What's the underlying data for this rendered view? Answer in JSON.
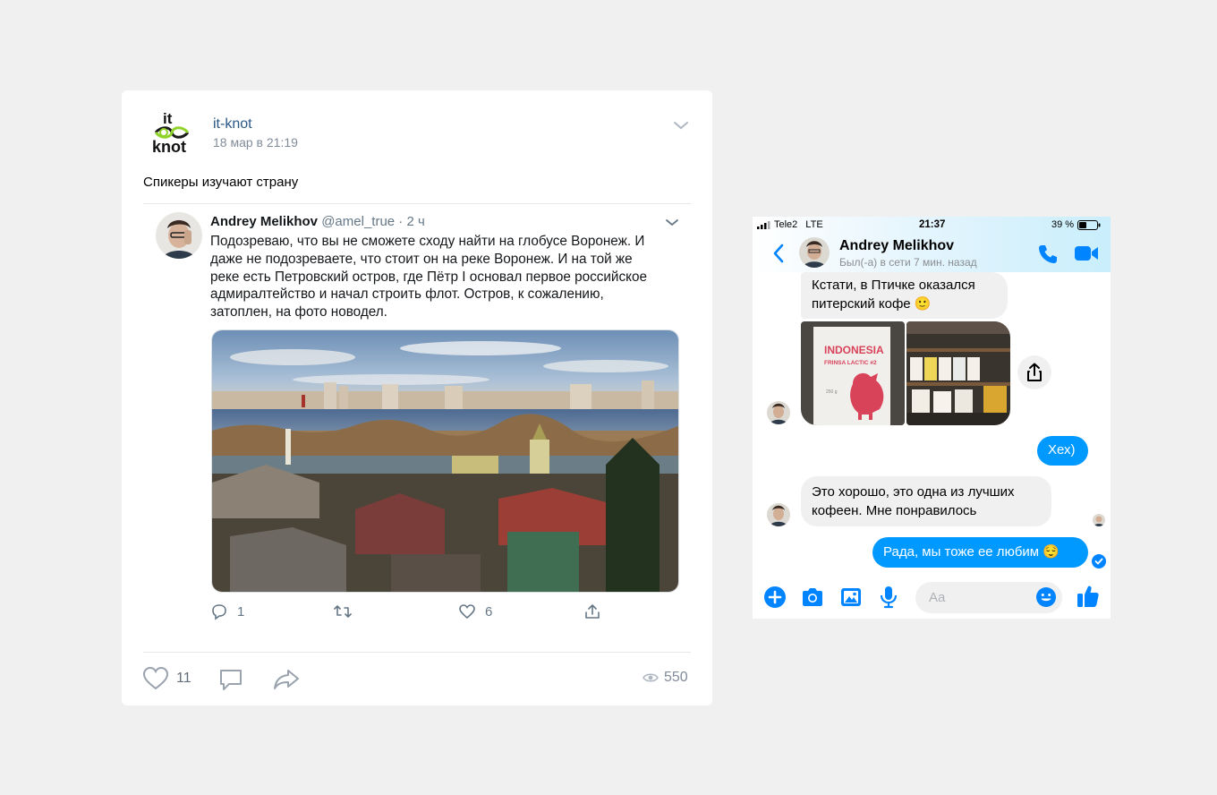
{
  "vk_post": {
    "author": "it-knot",
    "date": "18 мар в 21:19",
    "text": "Спикеры изучают страну",
    "logo_text_top": "it",
    "logo_text_bottom": "knot",
    "embedded_tweet": {
      "author": "Andrey Melikhov",
      "handle": "@amel_true",
      "time": " · 2 ч",
      "text_lines": [
        "Подозреваю, что вы не сможете сходу найти на глобусе Воронеж. И",
        "даже не подозреваете, что стоит он на реке Воронеж. И на той же",
        "реке есть Петровский остров, где Пётр I основал первое российское",
        "адмиралтейство и начал строить флот. Остров, к сожалению,",
        "затоплен, на фото новодел."
      ],
      "replies": "1",
      "retweets": "",
      "likes": "6"
    },
    "likes": "11",
    "views": "550",
    "icons": [
      "chevron-down-icon",
      "comment-icon",
      "retweet-icon",
      "heart-icon",
      "upload-icon",
      "like-icon",
      "share-icon",
      "eye-icon"
    ]
  },
  "messenger": {
    "status_bar": {
      "carrier": "Tele2",
      "network": "LTE",
      "time": "21:37",
      "battery": "39 %"
    },
    "contact_name": "Andrey Melikhov",
    "contact_status": "Был(-а) в сети 7 мин. назад",
    "messages": [
      {
        "from": "them",
        "lines": [
          "Кстати, в Птичке оказался",
          "питерский кофе 🙂"
        ]
      },
      {
        "from": "them",
        "type": "photos",
        "photo1_label_1": "INDONESIA",
        "photo1_label_2": "FRINSA LACTIC #2",
        "photo1_weight": "250 g"
      },
      {
        "from": "me",
        "lines": [
          "Хех)"
        ]
      },
      {
        "from": "them",
        "lines": [
          "Это хорошо, это одна из лучших",
          "кофеен. Мне понравилось"
        ]
      },
      {
        "from": "me",
        "lines": [
          "Рада, мы тоже ее любим 😌"
        ]
      }
    ],
    "composer_placeholder": "Aa",
    "accent_color": "#0099ff"
  }
}
